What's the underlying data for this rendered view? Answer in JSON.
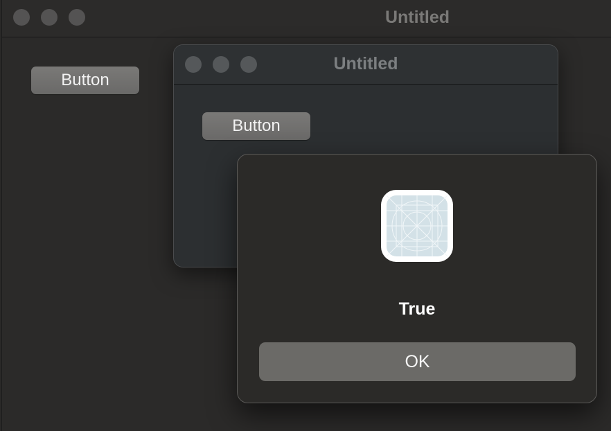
{
  "main_window": {
    "title": "Untitled",
    "button_label": "Button"
  },
  "middle_window": {
    "title": "Untitled",
    "button_label": "Button"
  },
  "alert": {
    "icon": "app-placeholder-icon",
    "message": "True",
    "ok_label": "OK"
  }
}
